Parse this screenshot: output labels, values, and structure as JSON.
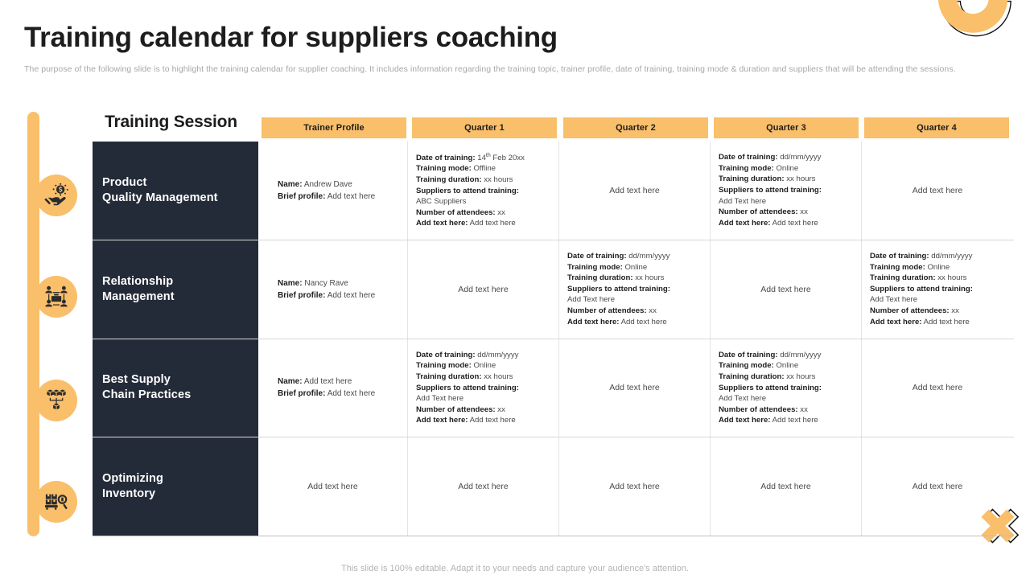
{
  "header": {
    "title": "Training calendar for suppliers coaching",
    "subtitle": "The purpose of the following slide is to highlight the training calendar for supplier coaching. It includes information regarding the training topic, trainer profile, date of training, training mode & duration and suppliers that will be attending the sessions."
  },
  "theme": {
    "accent": "#f9bf6b",
    "dark": "#242b38",
    "text": "#1d1d1d",
    "muted": "#a8a8a8"
  },
  "table": {
    "session_label": "Training Session",
    "columns": [
      {
        "label": "Trainer Profile",
        "icon": "trainer-profile-header"
      },
      {
        "label": "Quarter 1",
        "icon": "quarter-1-header"
      },
      {
        "label": "Quarter 2",
        "icon": "quarter-2-header"
      },
      {
        "label": "Quarter 3",
        "icon": "quarter-3-header"
      },
      {
        "label": "Quarter 4",
        "icon": "quarter-4-header"
      }
    ],
    "field_labels": {
      "date": "Date of training:",
      "mode": "Training mode:",
      "duration": "Training duration:",
      "suppliers": "Suppliers to attend training:",
      "attendees": "Number of attendees:",
      "extra": "Add text here:",
      "name": "Name:",
      "brief": "Brief profile:"
    },
    "placeholder_text": "Add text here",
    "rows": [
      {
        "icon": "hand-holding-money-icon",
        "topic_line1": "Product",
        "topic_line2": "Quality Management",
        "trainer": {
          "name": "Andrew Dave",
          "brief": "Add text here"
        },
        "q1": {
          "filled": true,
          "date": "14",
          "date_sup": "th",
          "date_rest": " Feb 20xx",
          "mode": "Offline",
          "duration": "xx hours",
          "suppliers": "ABC Suppliers",
          "attendees": "xx",
          "extra": "Add text here"
        },
        "q2": {
          "filled": false,
          "text": "Add text here"
        },
        "q3": {
          "filled": true,
          "date": "dd/mm/yyyy",
          "date_sup": "",
          "date_rest": "",
          "mode": "Online",
          "duration": "xx hours",
          "suppliers": "Add Text here",
          "attendees": "xx",
          "extra": "Add text here"
        },
        "q4": {
          "filled": false,
          "text": "Add text here"
        }
      },
      {
        "icon": "team-network-briefcase-icon",
        "topic_line1": "Relationship",
        "topic_line2": "Management",
        "trainer": {
          "name": "Nancy Rave",
          "brief": "Add text here"
        },
        "q1": {
          "filled": false,
          "text": "Add text here"
        },
        "q2": {
          "filled": true,
          "date": "dd/mm/yyyy",
          "date_sup": "",
          "date_rest": "",
          "mode": "Online",
          "duration": "xx hours",
          "suppliers": "Add Text here",
          "attendees": "xx",
          "extra": "Add text here"
        },
        "q3": {
          "filled": false,
          "text": "Add text here"
        },
        "q4": {
          "filled": true,
          "date": "dd/mm/yyyy",
          "date_sup": "",
          "date_rest": "",
          "mode": "Online",
          "duration": "xx hours",
          "suppliers": "Add Text here",
          "attendees": "xx",
          "extra": "Add text here"
        }
      },
      {
        "icon": "distribution-tree-icon",
        "topic_line1": "Best Supply",
        "topic_line2": "Chain Practices",
        "trainer": {
          "name": "Add text here",
          "brief": "Add text here"
        },
        "q1": {
          "filled": true,
          "date": "dd/mm/yyyy",
          "date_sup": "",
          "date_rest": "",
          "mode": "Online",
          "duration": "xx hours",
          "suppliers": "Add Text here",
          "attendees": "xx",
          "extra": "Add text here"
        },
        "q2": {
          "filled": false,
          "text": "Add text here"
        },
        "q3": {
          "filled": true,
          "date": "dd/mm/yyyy",
          "date_sup": "",
          "date_rest": "",
          "mode": "Online",
          "duration": "xx hours",
          "suppliers": "Add Text here",
          "attendees": "xx",
          "extra": "Add text here"
        },
        "q4": {
          "filled": false,
          "text": "Add text here"
        }
      },
      {
        "icon": "inventory-search-icon",
        "topic_line1": "Optimizing",
        "topic_line2": "Inventory",
        "trainer_plain": "Add text here",
        "q1": {
          "filled": false,
          "text": "Add text here"
        },
        "q2": {
          "filled": false,
          "text": "Add text here"
        },
        "q3": {
          "filled": false,
          "text": "Add text here"
        },
        "q4": {
          "filled": false,
          "text": "Add text here"
        }
      }
    ]
  },
  "footer": {
    "note": "This slide is 100% editable. Adapt it to your needs and capture your audience's attention."
  }
}
